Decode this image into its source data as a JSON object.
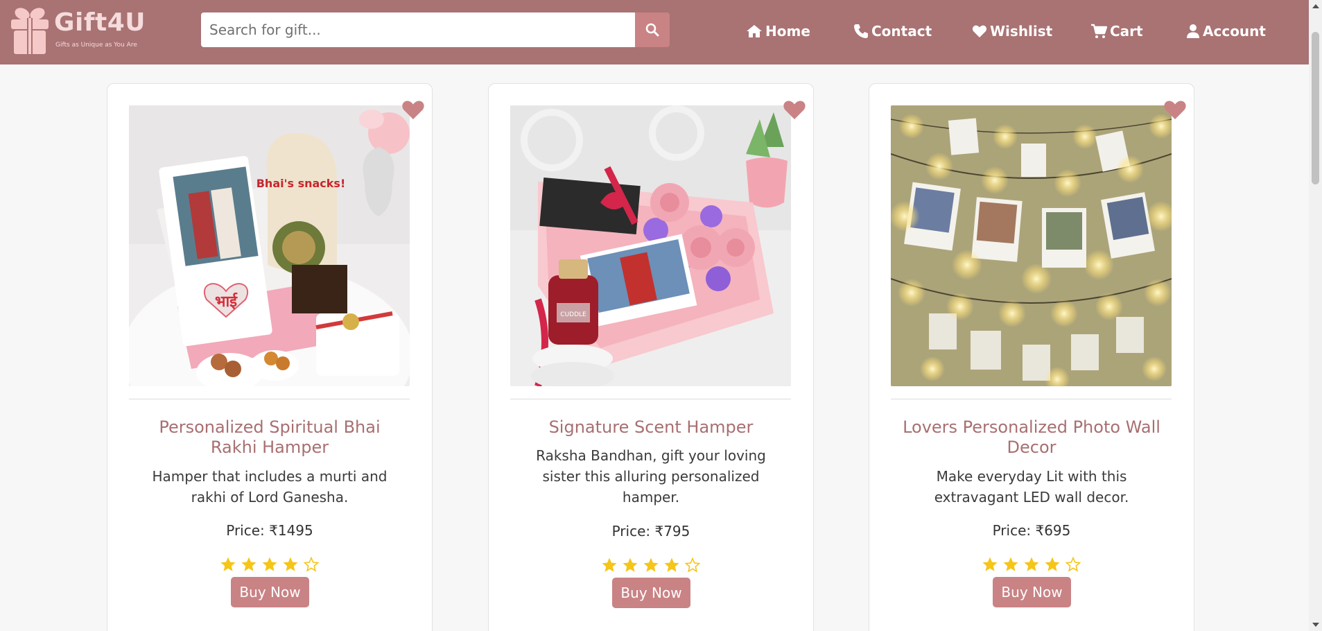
{
  "header": {
    "logo": {
      "name": "Gift4U",
      "tagline": "Gifts as Unique as You Are"
    },
    "search": {
      "placeholder": "Search for gift...",
      "value": ""
    },
    "nav": [
      {
        "label": "Home",
        "icon": "home-icon"
      },
      {
        "label": "Contact",
        "icon": "phone-icon"
      },
      {
        "label": "Wishlist",
        "icon": "heart-icon"
      },
      {
        "label": "Cart",
        "icon": "cart-icon"
      },
      {
        "label": "Account",
        "icon": "user-icon"
      }
    ]
  },
  "products": [
    {
      "title": "Personalized Spiritual Bhai Rakhi Hamper",
      "description": "Hamper that includes a murti and rakhi of Lord Ganesha.",
      "price": "Price: ₹1495",
      "rating": 4,
      "rating_max": 5,
      "button": "Buy Now",
      "image_text": {
        "bag": "Bhai's snacks!",
        "heart": "भाई"
      }
    },
    {
      "title": "Signature Scent Hamper",
      "description": "Raksha Bandhan, gift your loving sister this alluring personalized hamper.",
      "price": "Price: ₹795",
      "rating": 4,
      "rating_max": 5,
      "button": "Buy Now",
      "image_text": {
        "bottle": "CUDDLE"
      }
    },
    {
      "title": "Lovers Personalized Photo Wall Decor",
      "description": "Make everyday Lit with this extravagant LED wall decor.",
      "price": "Price: ₹695",
      "rating": 4,
      "rating_max": 5,
      "button": "Buy Now"
    }
  ],
  "colors": {
    "header_bg": "#a97273",
    "accent": "#c98385",
    "title": "#a86f71",
    "star": "#f5c518",
    "page_bg": "#f7f7f7"
  }
}
